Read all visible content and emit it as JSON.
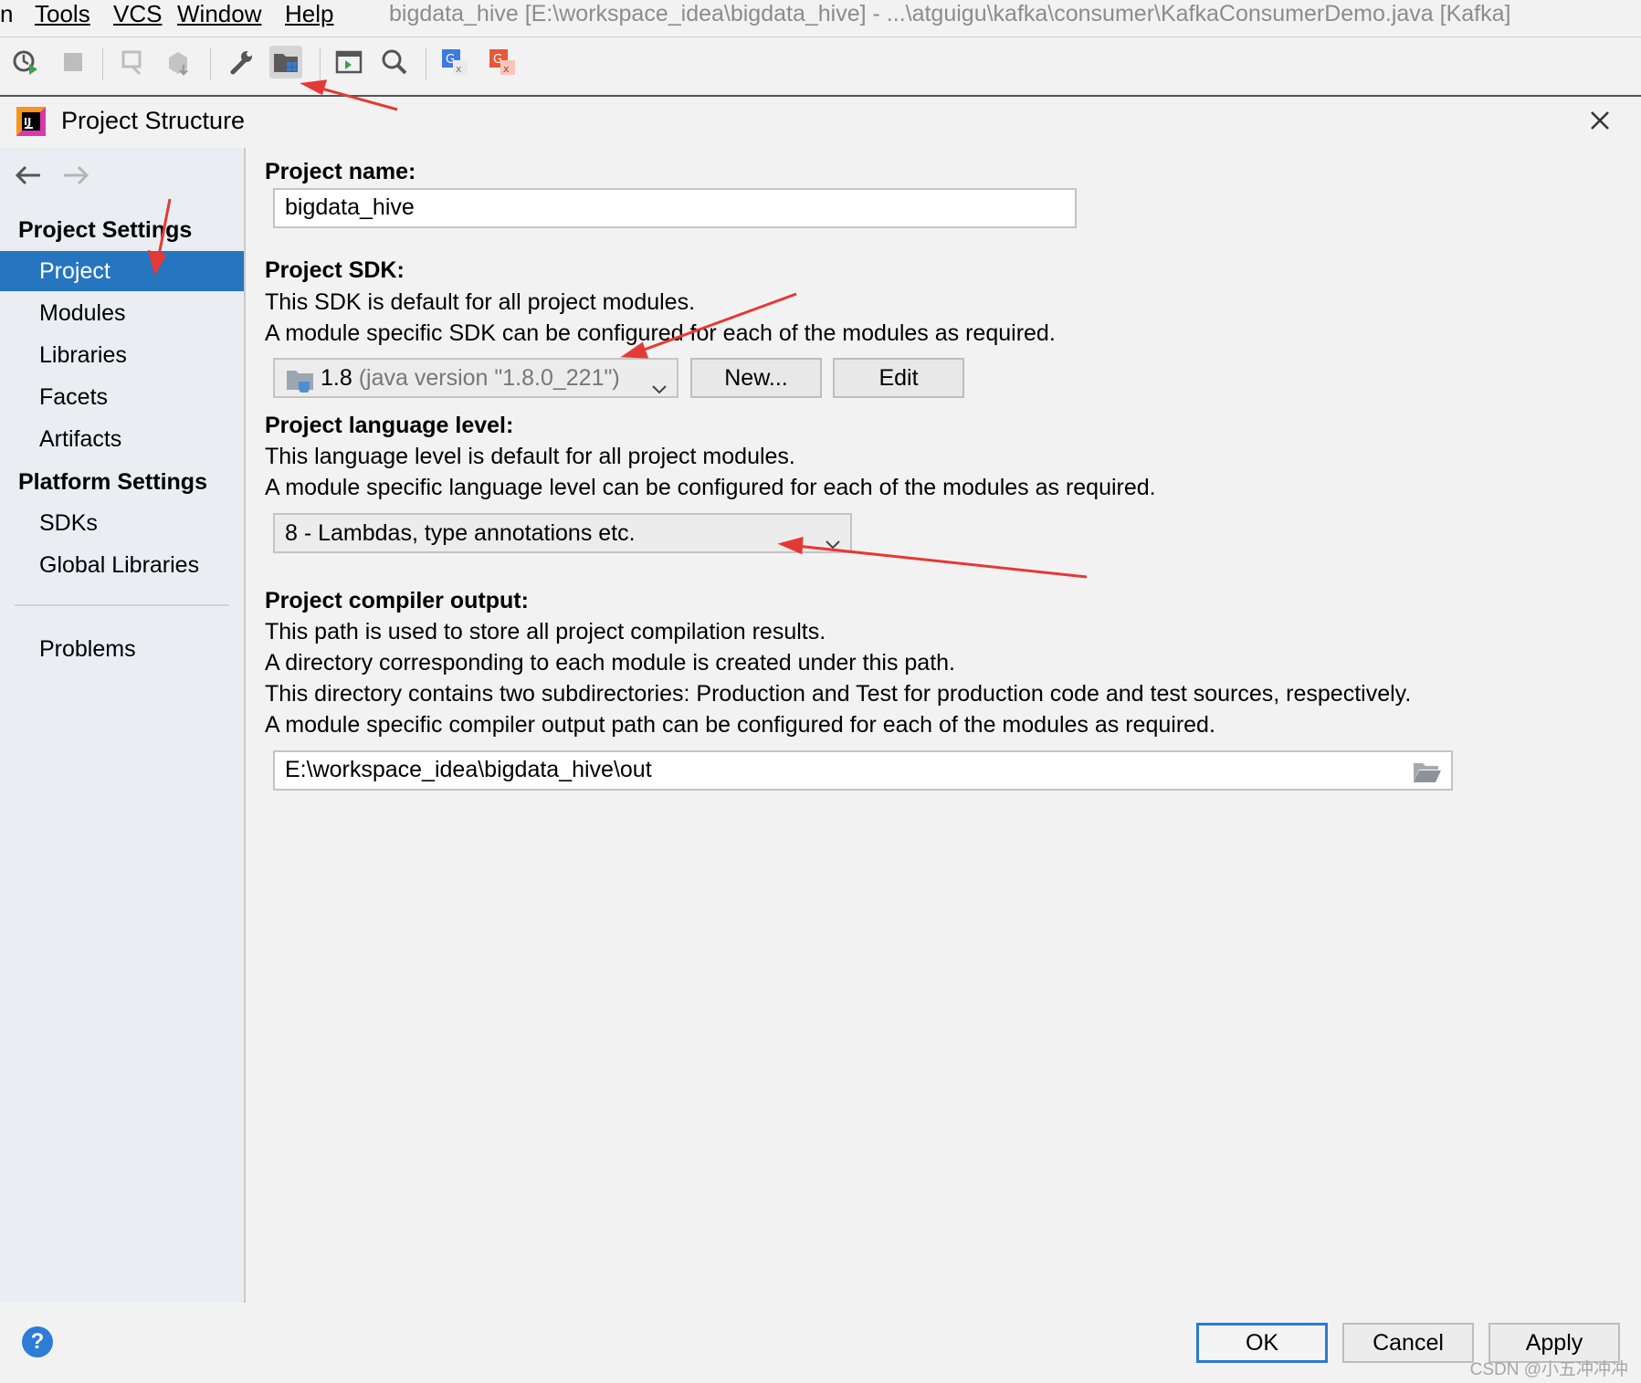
{
  "menubar": {
    "items": [
      "n",
      "Tools",
      "VCS",
      "Window",
      "Help"
    ],
    "window_title": "bigdata_hive [E:\\workspace_idea\\bigdata_hive] - ...\\atguigu\\kafka\\consumer\\KafkaConsumerDemo.java [Kafka]"
  },
  "dialog": {
    "title": "Project Structure"
  },
  "sidebar": {
    "project_settings_heading": "Project Settings",
    "project_items": [
      "Project",
      "Modules",
      "Libraries",
      "Facets",
      "Artifacts"
    ],
    "platform_settings_heading": "Platform Settings",
    "platform_items": [
      "SDKs",
      "Global Libraries"
    ],
    "problems": "Problems",
    "selected": "Project"
  },
  "main": {
    "project_name_label": "Project name:",
    "project_name_value": "bigdata_hive",
    "sdk_label": "Project SDK:",
    "sdk_desc1": "This SDK is default for all project modules.",
    "sdk_desc2": "A module specific SDK can be configured for each of the modules as required.",
    "sdk_value": "1.8",
    "sdk_version": "(java version \"1.8.0_221\")",
    "sdk_new_button": "New...",
    "sdk_edit_button": "Edit",
    "lang_label": "Project language level:",
    "lang_desc1": "This language level is default for all project modules.",
    "lang_desc2": "A module specific language level can be configured for each of the modules as required.",
    "lang_value": "8 - Lambdas, type annotations etc.",
    "output_label": "Project compiler output:",
    "output_desc1": "This path is used to store all project compilation results.",
    "output_desc2": "A directory corresponding to each module is created under this path.",
    "output_desc3": "This directory contains two subdirectories: Production and Test for production code and test sources, respectively.",
    "output_desc4": "A module specific compiler output path can be configured for each of the modules as required.",
    "output_value": "E:\\workspace_idea\\bigdata_hive\\out"
  },
  "footer": {
    "help": "?",
    "ok": "OK",
    "cancel": "Cancel",
    "apply": "Apply",
    "watermark": "CSDN @小五冲冲冲"
  },
  "colors": {
    "selection": "#2675bf",
    "annotation_arrow": "#e53935",
    "primary_border": "#2a7ad2"
  }
}
